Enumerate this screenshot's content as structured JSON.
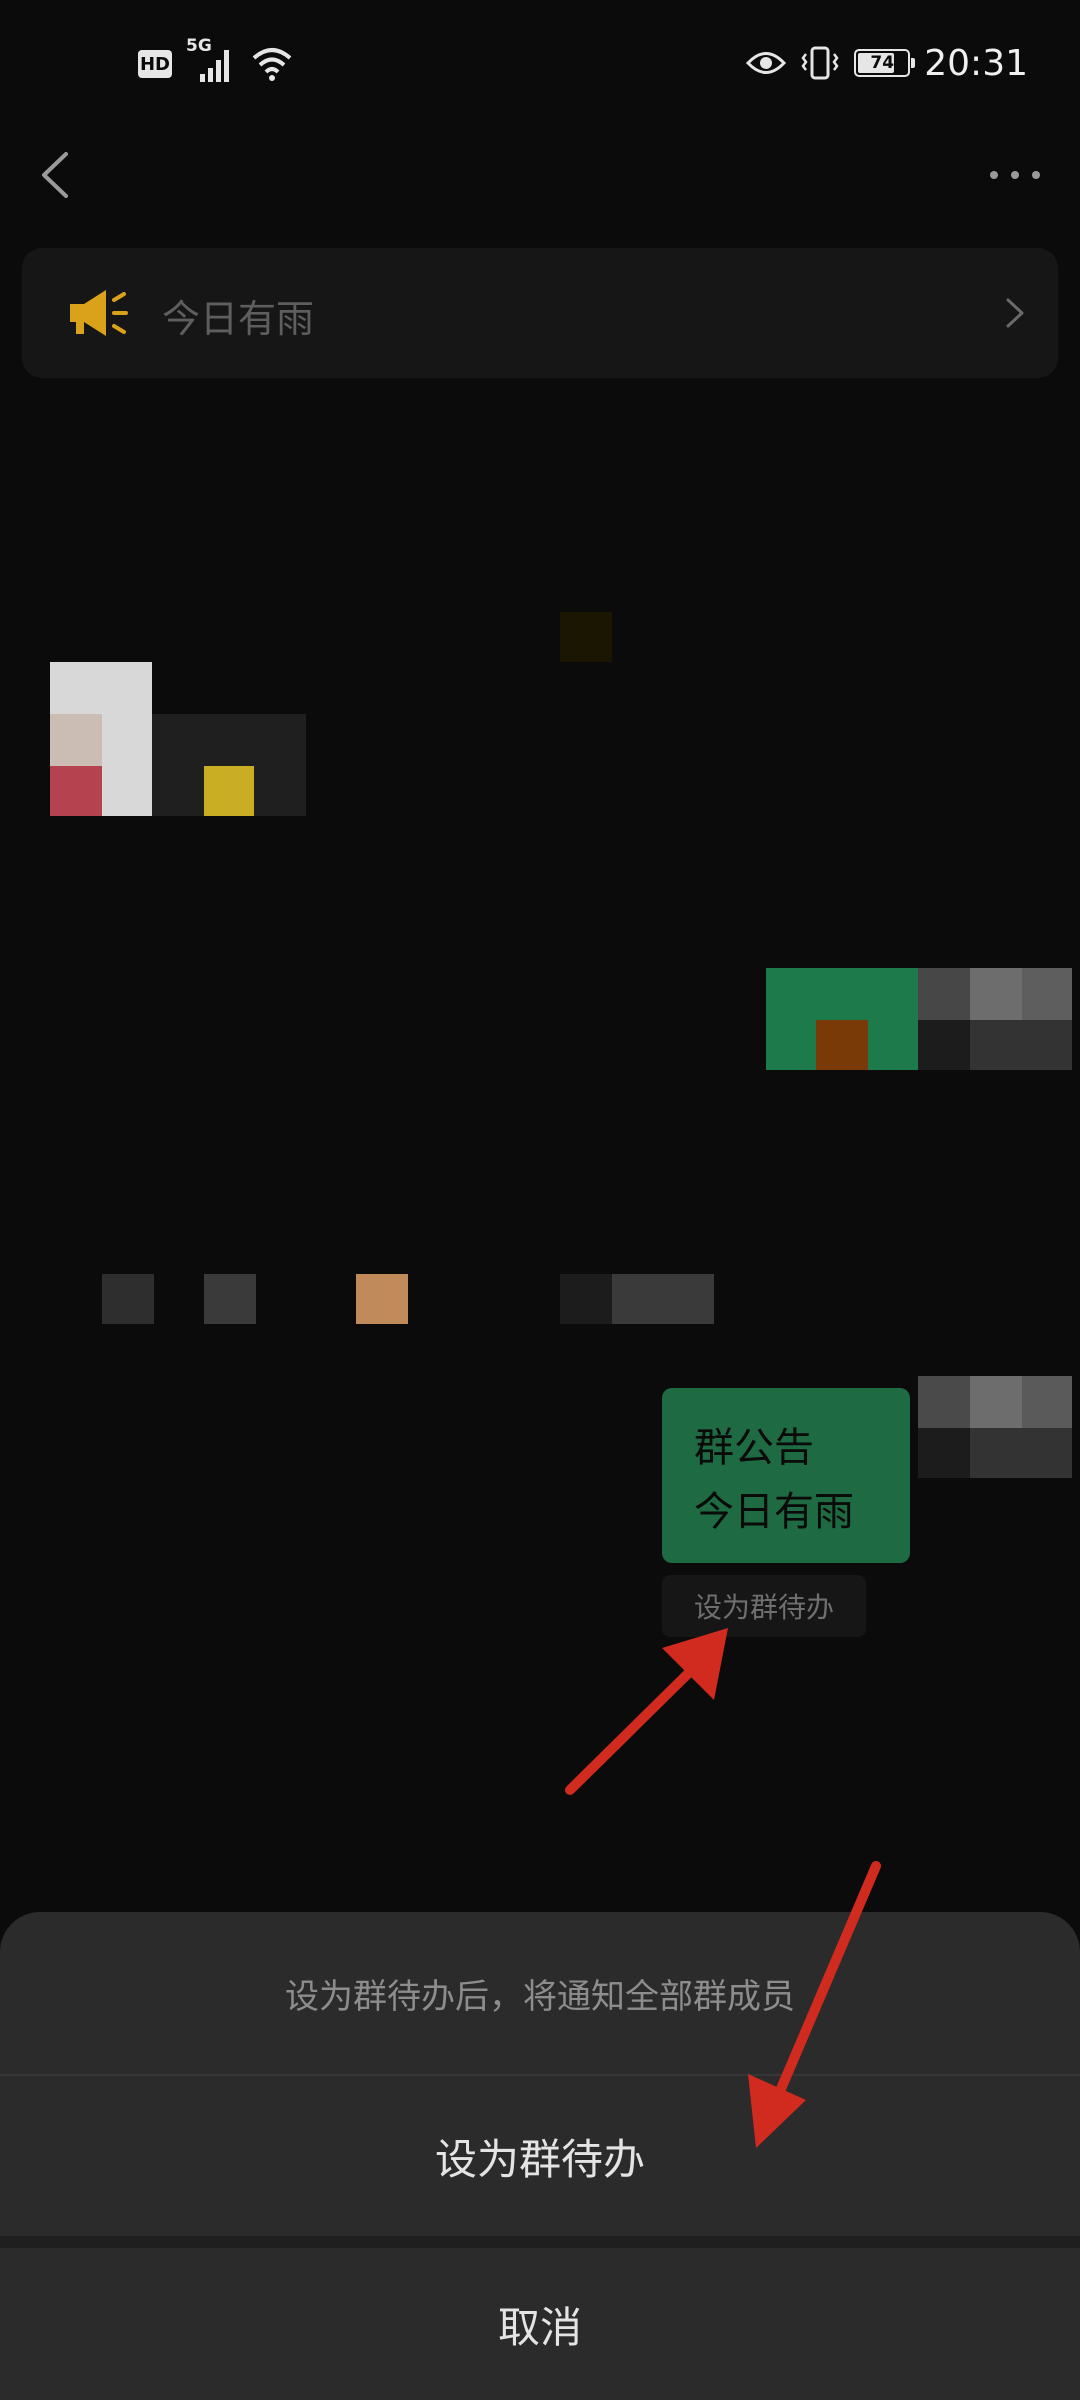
{
  "status_bar": {
    "hd_label": "HD",
    "network_label": "5G",
    "battery_level": "74",
    "time": "20:31",
    "icons": [
      "signal-icon",
      "wifi-icon",
      "eye-icon",
      "vibrate-icon",
      "battery-icon"
    ]
  },
  "nav": {
    "back_icon": "chevron-left-icon",
    "more_icon": "more-dots-icon"
  },
  "announcement": {
    "icon": "megaphone-icon",
    "text": "今日有雨",
    "accent_color": "#d9a21a"
  },
  "message": {
    "line1": "群公告",
    "line2": "今日有雨",
    "bubble_color": "#1e6a43",
    "todo_tag": "设为群待办"
  },
  "sheet": {
    "hint": "设为群待办后，将通知全部群成员",
    "action_label": "设为群待办",
    "cancel_label": "取消"
  },
  "annotation_color": "#d12a1e"
}
